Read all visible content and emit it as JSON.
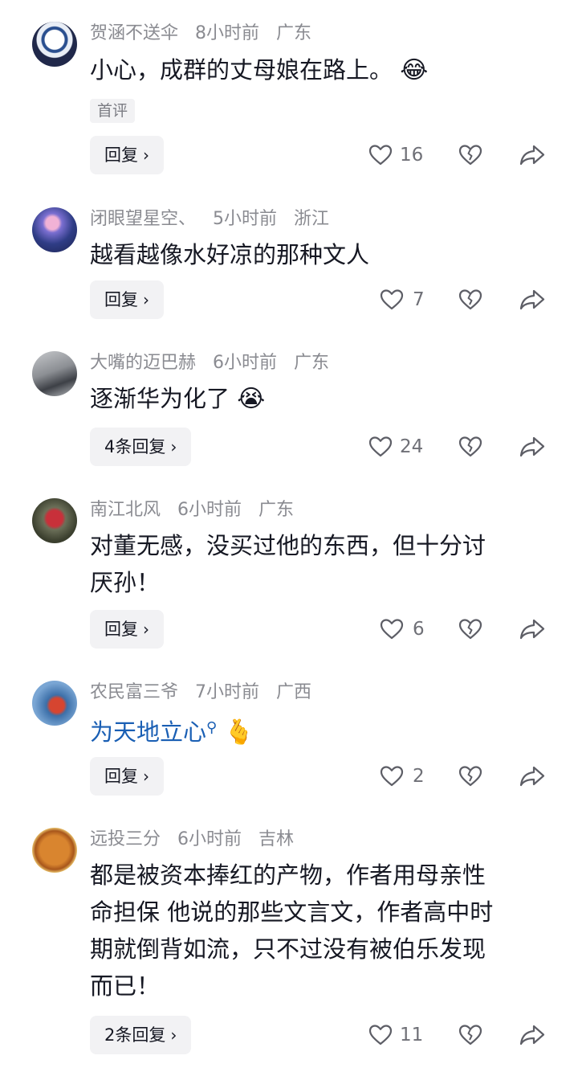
{
  "comments": [
    {
      "username": "贺涵不送伞",
      "time": "8小时前",
      "location": "广东",
      "text": "小心，成群的丈母娘在路上。",
      "emoji": "😂",
      "badge": "首评",
      "reply_label": "回复",
      "likes": "16"
    },
    {
      "username": "闭眼望星空、",
      "time": "5小时前",
      "location": "浙江",
      "text": "越看越像水好凉的那种文人",
      "reply_label": "回复",
      "likes": "7"
    },
    {
      "username": "大嘴的迈巴赫",
      "time": "6小时前",
      "location": "广东",
      "text": "逐渐华为化了",
      "emoji": "😭",
      "reply_label": "4条回复",
      "likes": "24"
    },
    {
      "username": "南江北风",
      "time": "6小时前",
      "location": "广东",
      "text_line1": "对董无感，没买过他的东西，但十分讨",
      "text_line2": "厌孙！",
      "reply_label": "回复",
      "likes": "6"
    },
    {
      "username": "农民富三爷",
      "time": "7小时前",
      "location": "广西",
      "link_text": "为天地立心",
      "emoji": "🫰",
      "reply_label": "回复",
      "likes": "2"
    },
    {
      "username": "远投三分",
      "time": "6小时前",
      "location": "吉林",
      "text_line1": "都是被资本捧红的产物，作者用母亲性",
      "text_line2": "命担保 他说的那些文言文，作者高中时",
      "text_line3": "期就倒背如流，只不过没有被伯乐发现",
      "text_line4": "而已！",
      "reply_label": "2条回复",
      "likes": "11"
    }
  ],
  "icons": {
    "chevron": "chevron-right-icon",
    "like": "heart-outline-icon",
    "dislike": "broken-heart-icon",
    "share": "share-arrow-icon"
  },
  "colors": {
    "text": "#161823",
    "meta": "#8a8b91",
    "link": "#1a5fb4",
    "chip_bg": "#f2f2f4"
  }
}
